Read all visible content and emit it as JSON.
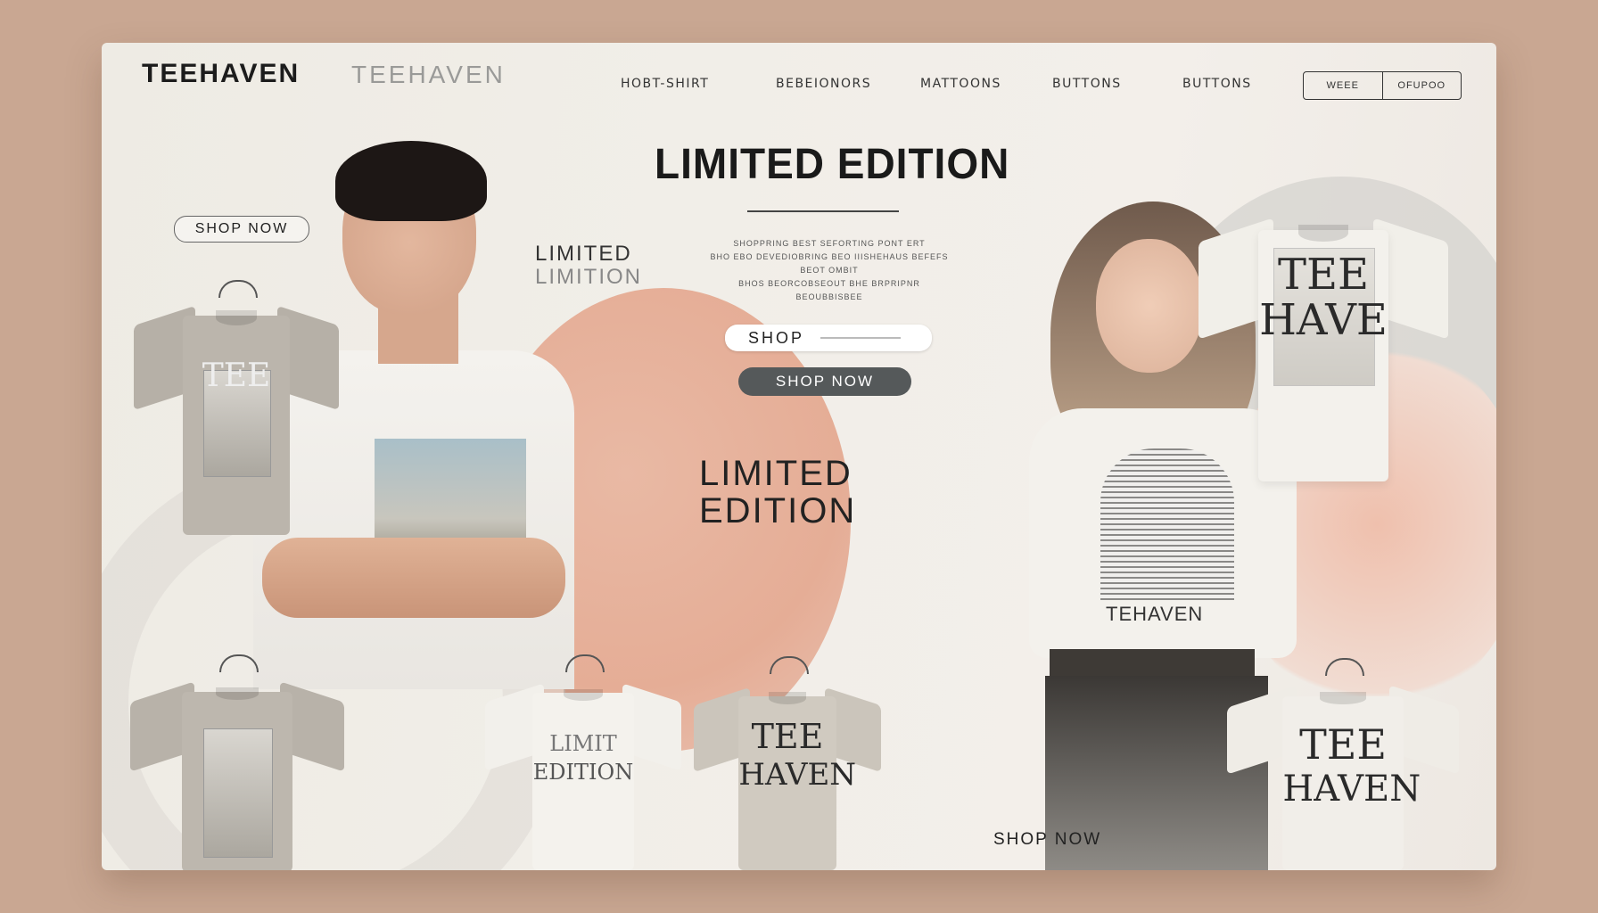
{
  "header": {
    "logo": "TEEHAVEN",
    "logo_secondary": "TEEHAVEN",
    "nav": [
      "HOBT-SHIRT",
      "BEBEIONORS",
      "MATTOONS",
      "BUTTONS",
      "BUTTONS"
    ],
    "buttons": [
      "WEEE",
      "OFUPOO"
    ]
  },
  "hero": {
    "title": "LIMITED EDITION",
    "side_label_line1": "LIMITED",
    "side_label_line2": "LIMITION",
    "description": [
      "SHOPPRING BEST SEFORTING PONT ERT",
      "BHO EBO DEVEDIOBRING BEO IIISHEHAUS BEFEFS BEOT OMBIT",
      "BHOS BEORCOBSEOUT BHE BRPRIPNR BEOUBBISBEE"
    ],
    "shop_label": "SHOP",
    "shop_now_dark": "SHOP NOW",
    "shop_now_left": "SHOP NOW",
    "mid_label_line1": "LIMITED",
    "mid_label_line2": "EDITION",
    "shop_now_bottom": "SHOP NOW"
  },
  "model": {
    "brand_on_shirt": "TEHAVEN"
  },
  "shirts": {
    "top_left": {
      "text": "TEE"
    },
    "top_right": {
      "line1": "TEE",
      "line2": "HAVE"
    },
    "bottom_mid": {
      "line1": "LIMIT",
      "line2": "EDITION"
    },
    "bottom_third": {
      "line1": "TEE",
      "line2": "HAVEN"
    },
    "bottom_right": {
      "line1": "TEE",
      "line2": "HAVEN"
    }
  }
}
